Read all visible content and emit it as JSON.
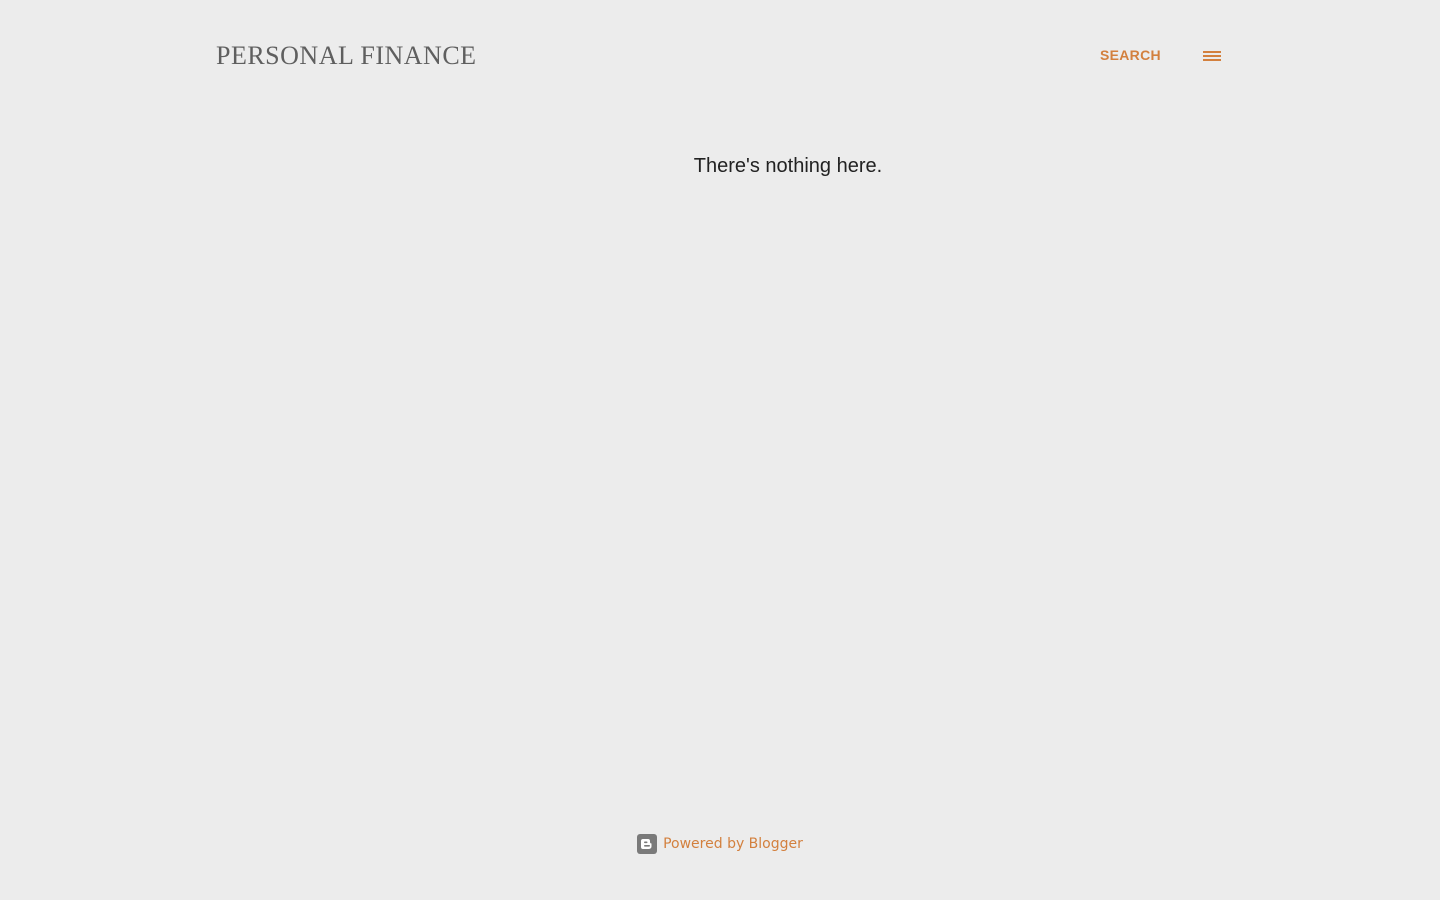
{
  "header": {
    "blog_title": "PERSONAL FINANCE",
    "search_label": "SEARCH",
    "menu_icon": "hamburger-menu-icon"
  },
  "main": {
    "empty_message": "There's nothing here."
  },
  "footer": {
    "powered_by_label": "Powered by Blogger",
    "blogger_icon": "blogger-logo-icon"
  },
  "colors": {
    "background": "#ececec",
    "accent": "#d3803e",
    "title": "#5f5f5f",
    "body_text": "#222222",
    "icon_gray": "#7a7a7a"
  }
}
